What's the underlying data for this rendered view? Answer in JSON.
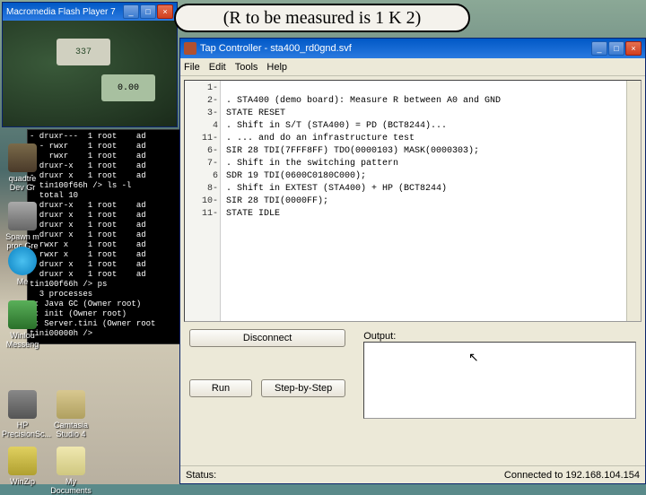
{
  "callout": {
    "text": "(R to be measured is 1 K 2)"
  },
  "flash_player": {
    "title": "Macromedia Flash Player 7",
    "meter1": "337",
    "meter2": "0.00"
  },
  "terminal": {
    "lines": "- druxr---  1 root    ad\n- - rwxr    1 root    ad\n    rwxr    1 root    ad\n- druxr-x   1 root    ad\n- druxr x   1 root    ad\n- tin100f66h /> ls -l\n  total 10\n  druxr-x   1 root    ad\n  druxr x   1 root    ad\n  druxr x   1 root    ad\n  druxr x   1 root    ad\n  rwxr x    1 root    ad\n  rwxr x    1 root    ad\n  druxr x   1 root    ad\n  druxr x   1 root    ad\ntin100f66h /> ps\n  3 processes\n1: Java GC (Owner root)\n2: init (Owner root)\n3: Server.tini (Owner root\ntini00000h />"
  },
  "desktop_icons": {
    "quadtree": "quadtre\nDev Gr",
    "spawn": "Spawn m\nproc Gre",
    "skype": "Me",
    "winlog": "Winlou\nMesseng",
    "hp": "HP\nPrecisionSc...",
    "cat": "Camtasia\nStudio 4",
    "winzip": "WinZip",
    "docs": "My Documents"
  },
  "main_window": {
    "title": "Tap Controller - sta400_rd0gnd.svf",
    "menu": {
      "file": "File",
      "edit": "Edit",
      "tools": "Tools",
      "help": "Help"
    },
    "gutter": [
      "1-",
      "2-",
      "3-",
      "4",
      "11-",
      "6-",
      "7-",
      "6",
      "8-",
      "10-",
      "11-"
    ],
    "code_lines": [
      ". STA400 (demo board): Measure R between A0 and GND",
      "STATE RESET",
      ". Shift in S/T (STA400) = PD (BCT8244)...",
      ". ... and do an infrastructure test",
      "SIR 28 TDI(7FFF8FF) TDO(0000103) MASK(0000303);",
      ". Shift in the switching pattern",
      "SDR 19 TDI(0600C0180C000);",
      ". Shift in EXTEST (STA400) + HP (BCT8244)",
      "SIR 28 TDI(0000FF);",
      "STATE IDLE"
    ],
    "buttons": {
      "disconnect": "Disconnect",
      "run": "Run",
      "step": "Step-by-Step"
    },
    "output_label": "Output:",
    "status_prefix": "Status:",
    "status_text": "Connected to 192.168.104.154"
  }
}
